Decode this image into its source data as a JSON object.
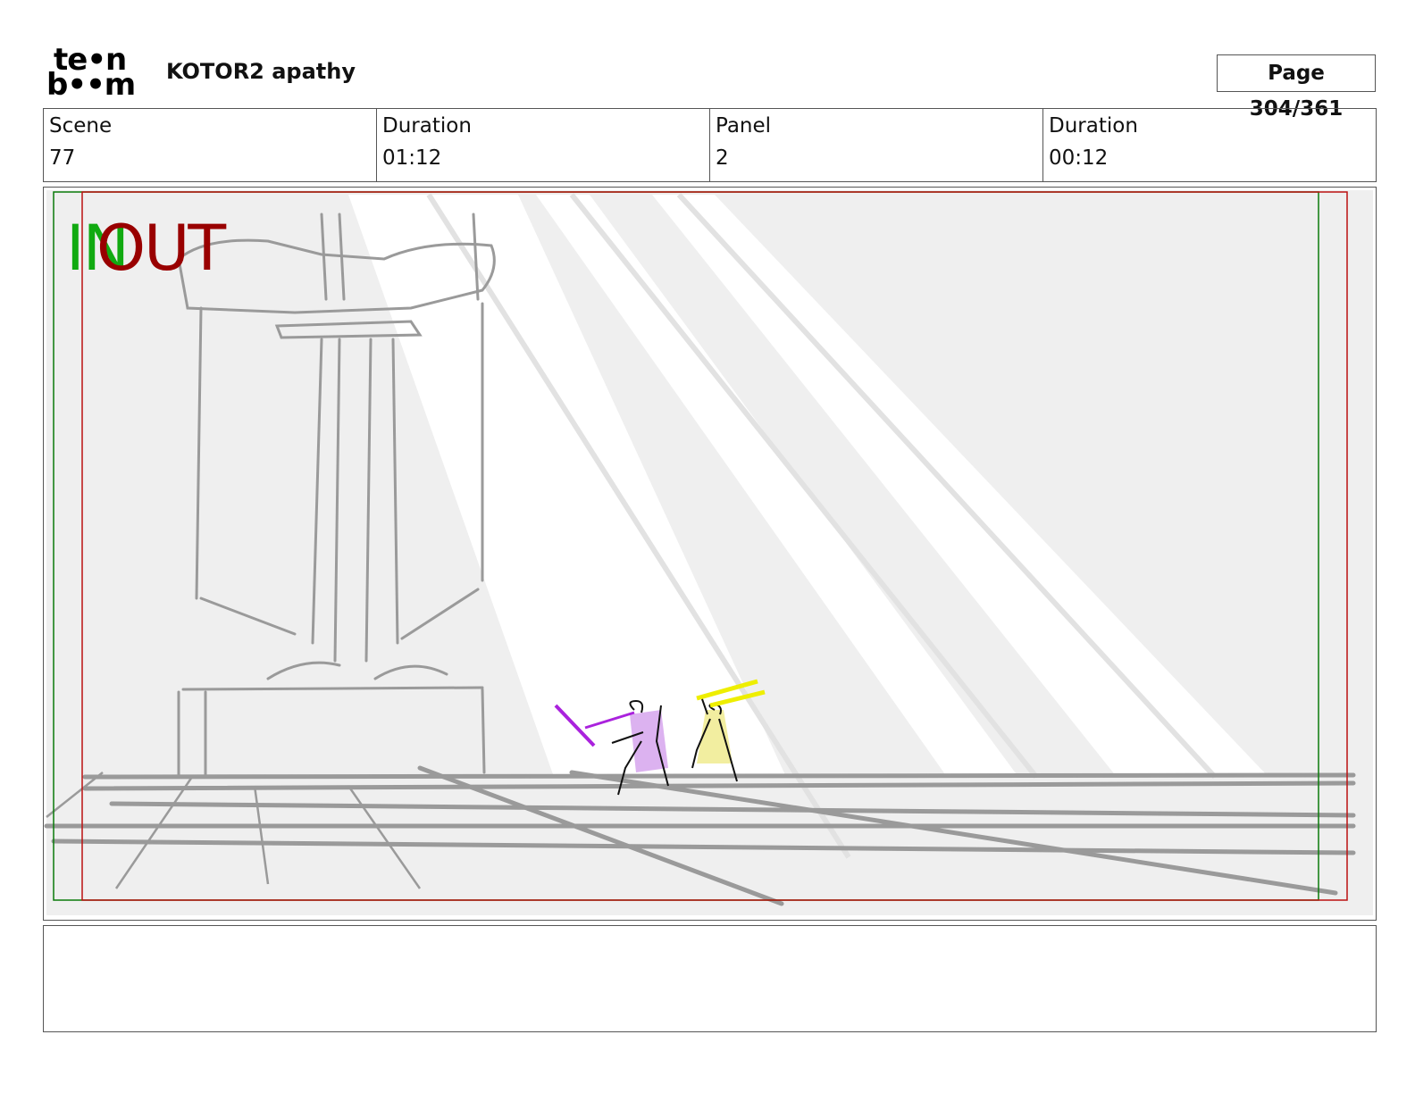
{
  "header": {
    "logo_line1": "te•n",
    "logo_line2": "b••m",
    "project_title": "KOTOR2 apathy",
    "page_label": "Page 304/361"
  },
  "info": [
    {
      "label": "Scene",
      "value": "77"
    },
    {
      "label": "Duration",
      "value": "01:12"
    },
    {
      "label": "Panel",
      "value": "2"
    },
    {
      "label": "Duration",
      "value": "00:12"
    }
  ],
  "panel": {
    "in_marker": "IN",
    "out_marker": "OUT",
    "colors": {
      "in_frame": "#0a7a0a",
      "out_frame": "#bb1111",
      "sketch": "#9a9a9a",
      "purple_saber": "#aa22dd",
      "yellow_saber": "#eeee00"
    }
  },
  "notes": {
    "text": ""
  }
}
